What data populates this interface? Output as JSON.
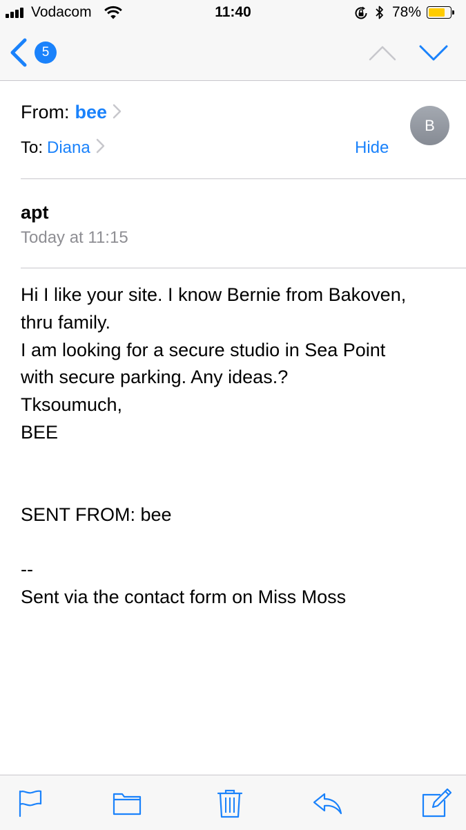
{
  "status_bar": {
    "carrier": "Vodacom",
    "time": "11:40",
    "battery_percent": "78%",
    "battery_level": 0.78,
    "signal_bars": 4,
    "icons": [
      "signal-icon",
      "wifi-icon",
      "rotation-lock-icon",
      "bluetooth-icon",
      "battery-icon"
    ]
  },
  "nav": {
    "back_icon": "chevron-left-icon",
    "unread_count": "5",
    "prev_icon": "chevron-up-icon",
    "next_icon": "chevron-down-icon"
  },
  "header": {
    "from_label": "From:",
    "from_name": "bee",
    "to_label": "To:",
    "to_name": "Diana",
    "hide_label": "Hide",
    "avatar_initial": "B"
  },
  "message": {
    "subject": "apt",
    "date": "Today at 11:15",
    "body_lines": [
      "Hi I like your site. I know Bernie from Bakoven,",
      "thru family.",
      "I am looking for a secure studio in Sea Point",
      "with secure parking. Any ideas.?",
      "Tksoumuch,",
      "BEE",
      "SENT FROM: bee",
      "--",
      "Sent via the contact form on Miss Moss"
    ]
  },
  "toolbar": {
    "icons": [
      "flag-icon",
      "folder-icon",
      "trash-icon",
      "reply-icon",
      "compose-icon"
    ]
  },
  "colors": {
    "accent": "#1a82fb",
    "secondary_text": "#8e8e93",
    "bar_background": "#f7f7f7",
    "battery_fill": "#ffcc00"
  }
}
